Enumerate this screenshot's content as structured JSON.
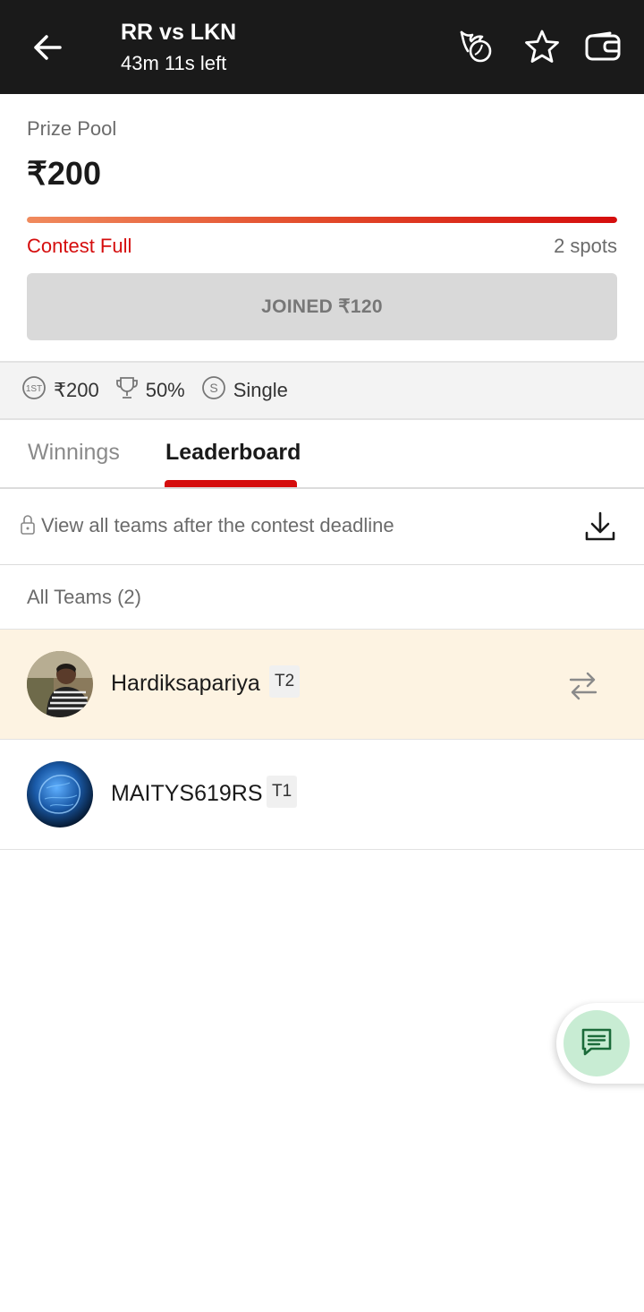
{
  "header": {
    "title": "RR vs LKN",
    "subtitle": "43m 11s left",
    "icons": [
      "back-arrow-icon",
      "fire-ball-icon",
      "star-icon",
      "wallet-icon"
    ]
  },
  "contest": {
    "prize_label": "Prize Pool",
    "prize_amount": "₹200",
    "fill_fraction": 1.0,
    "status": "Contest Full",
    "spots": "2 spots",
    "joined_label": "JOINED ₹120"
  },
  "info": {
    "first_prize": "₹200",
    "win_percent": "50%",
    "entry_type": "Single"
  },
  "tabs": [
    {
      "label": "Winnings",
      "active": false
    },
    {
      "label": "Leaderboard",
      "active": true
    }
  ],
  "notice": {
    "locked_text": "View all teams after the contest deadline"
  },
  "teams_header": "All Teams (2)",
  "teams": [
    {
      "name": "Hardiksapariya",
      "badge": "T2",
      "highlighted": true
    },
    {
      "name": "MAITYS619RS",
      "badge": "T1",
      "highlighted": false
    }
  ],
  "colors": {
    "header_bg": "#1a1a1a",
    "accent_red": "#d50d0d",
    "highlight_row": "#fdf3e2",
    "chat_bg": "#c8ecd3"
  }
}
